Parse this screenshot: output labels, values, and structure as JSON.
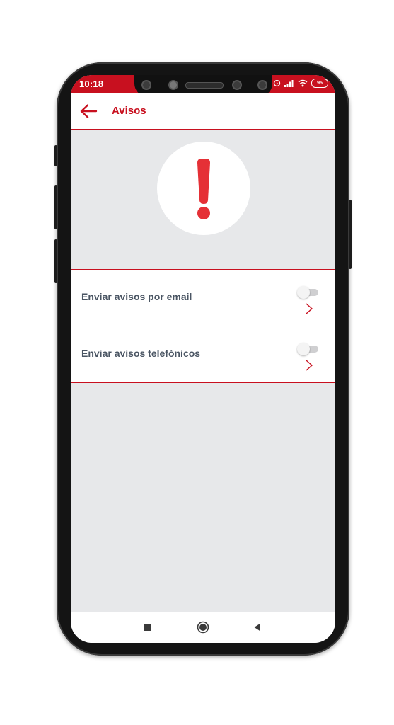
{
  "status_bar": {
    "time": "10:18",
    "battery": "95",
    "accent": "#c8101f"
  },
  "app_bar": {
    "title": "Avisos",
    "back_icon": "arrow-left-icon"
  },
  "hero": {
    "icon": "exclamation-icon",
    "color": "#e53036"
  },
  "settings": [
    {
      "label": "Enviar avisos por email",
      "enabled": false
    },
    {
      "label": "Enviar avisos telefónicos",
      "enabled": false
    }
  ],
  "nav_bar": {
    "buttons": [
      "recents-square-icon",
      "home-circle-icon",
      "back-triangle-icon"
    ]
  }
}
